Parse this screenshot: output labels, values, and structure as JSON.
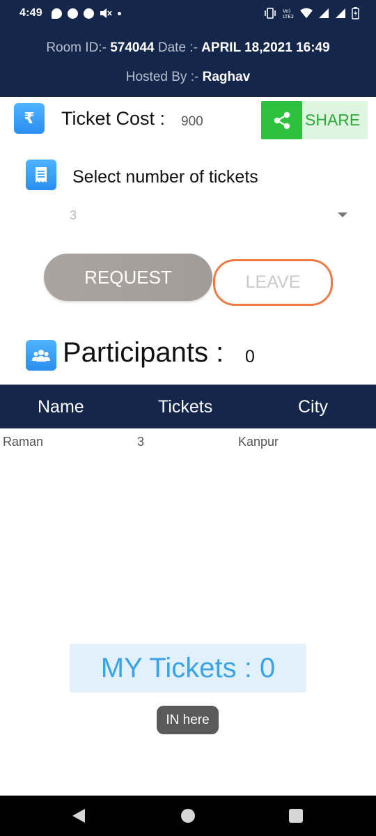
{
  "status_bar": {
    "time": "4:49",
    "left_icons": [
      "chat-icon",
      "notification-p-icon",
      "facebook-icon",
      "mute-icon",
      "dot-icon"
    ],
    "right_icons": [
      "vibrate-icon",
      "volte-icon",
      "wifi-icon",
      "signal-icon",
      "signal-icon",
      "battery-icon"
    ],
    "volte_text": "Vo)\nLTE2"
  },
  "header": {
    "room_id_label": "Room ID:- ",
    "room_id_value": "574044",
    "date_label": " Date :- ",
    "date_value": "APRIL 18,2021 16:49",
    "hosted_by_label": "Hosted By :- ",
    "hosted_by_value": "Raghav"
  },
  "ticket_cost": {
    "icon": "rupee-icon",
    "icon_glyph": "₹",
    "label": "Ticket Cost :",
    "value": "900"
  },
  "share": {
    "label": "SHARE",
    "icon": "share-icon"
  },
  "select_tickets": {
    "icon": "receipt-icon",
    "label": "Select number of tickets",
    "selected": "3"
  },
  "buttons": {
    "request": "REQUEST",
    "leave": "LEAVE"
  },
  "participants": {
    "icon": "group-icon",
    "label": "Participants :",
    "count": "0"
  },
  "table": {
    "headers": [
      "Name",
      "Tickets",
      "City"
    ],
    "rows": [
      {
        "name": "Raman",
        "tickets": "3",
        "city": "Kanpur"
      }
    ]
  },
  "my_tickets": {
    "label": "MY Tickets : 0"
  },
  "toast": {
    "text": "IN here"
  },
  "colors": {
    "header_bg": "#14274a",
    "accent_blue": "#3aa3e3",
    "share_green": "#2cc23d",
    "leave_orange": "#f07a45"
  }
}
